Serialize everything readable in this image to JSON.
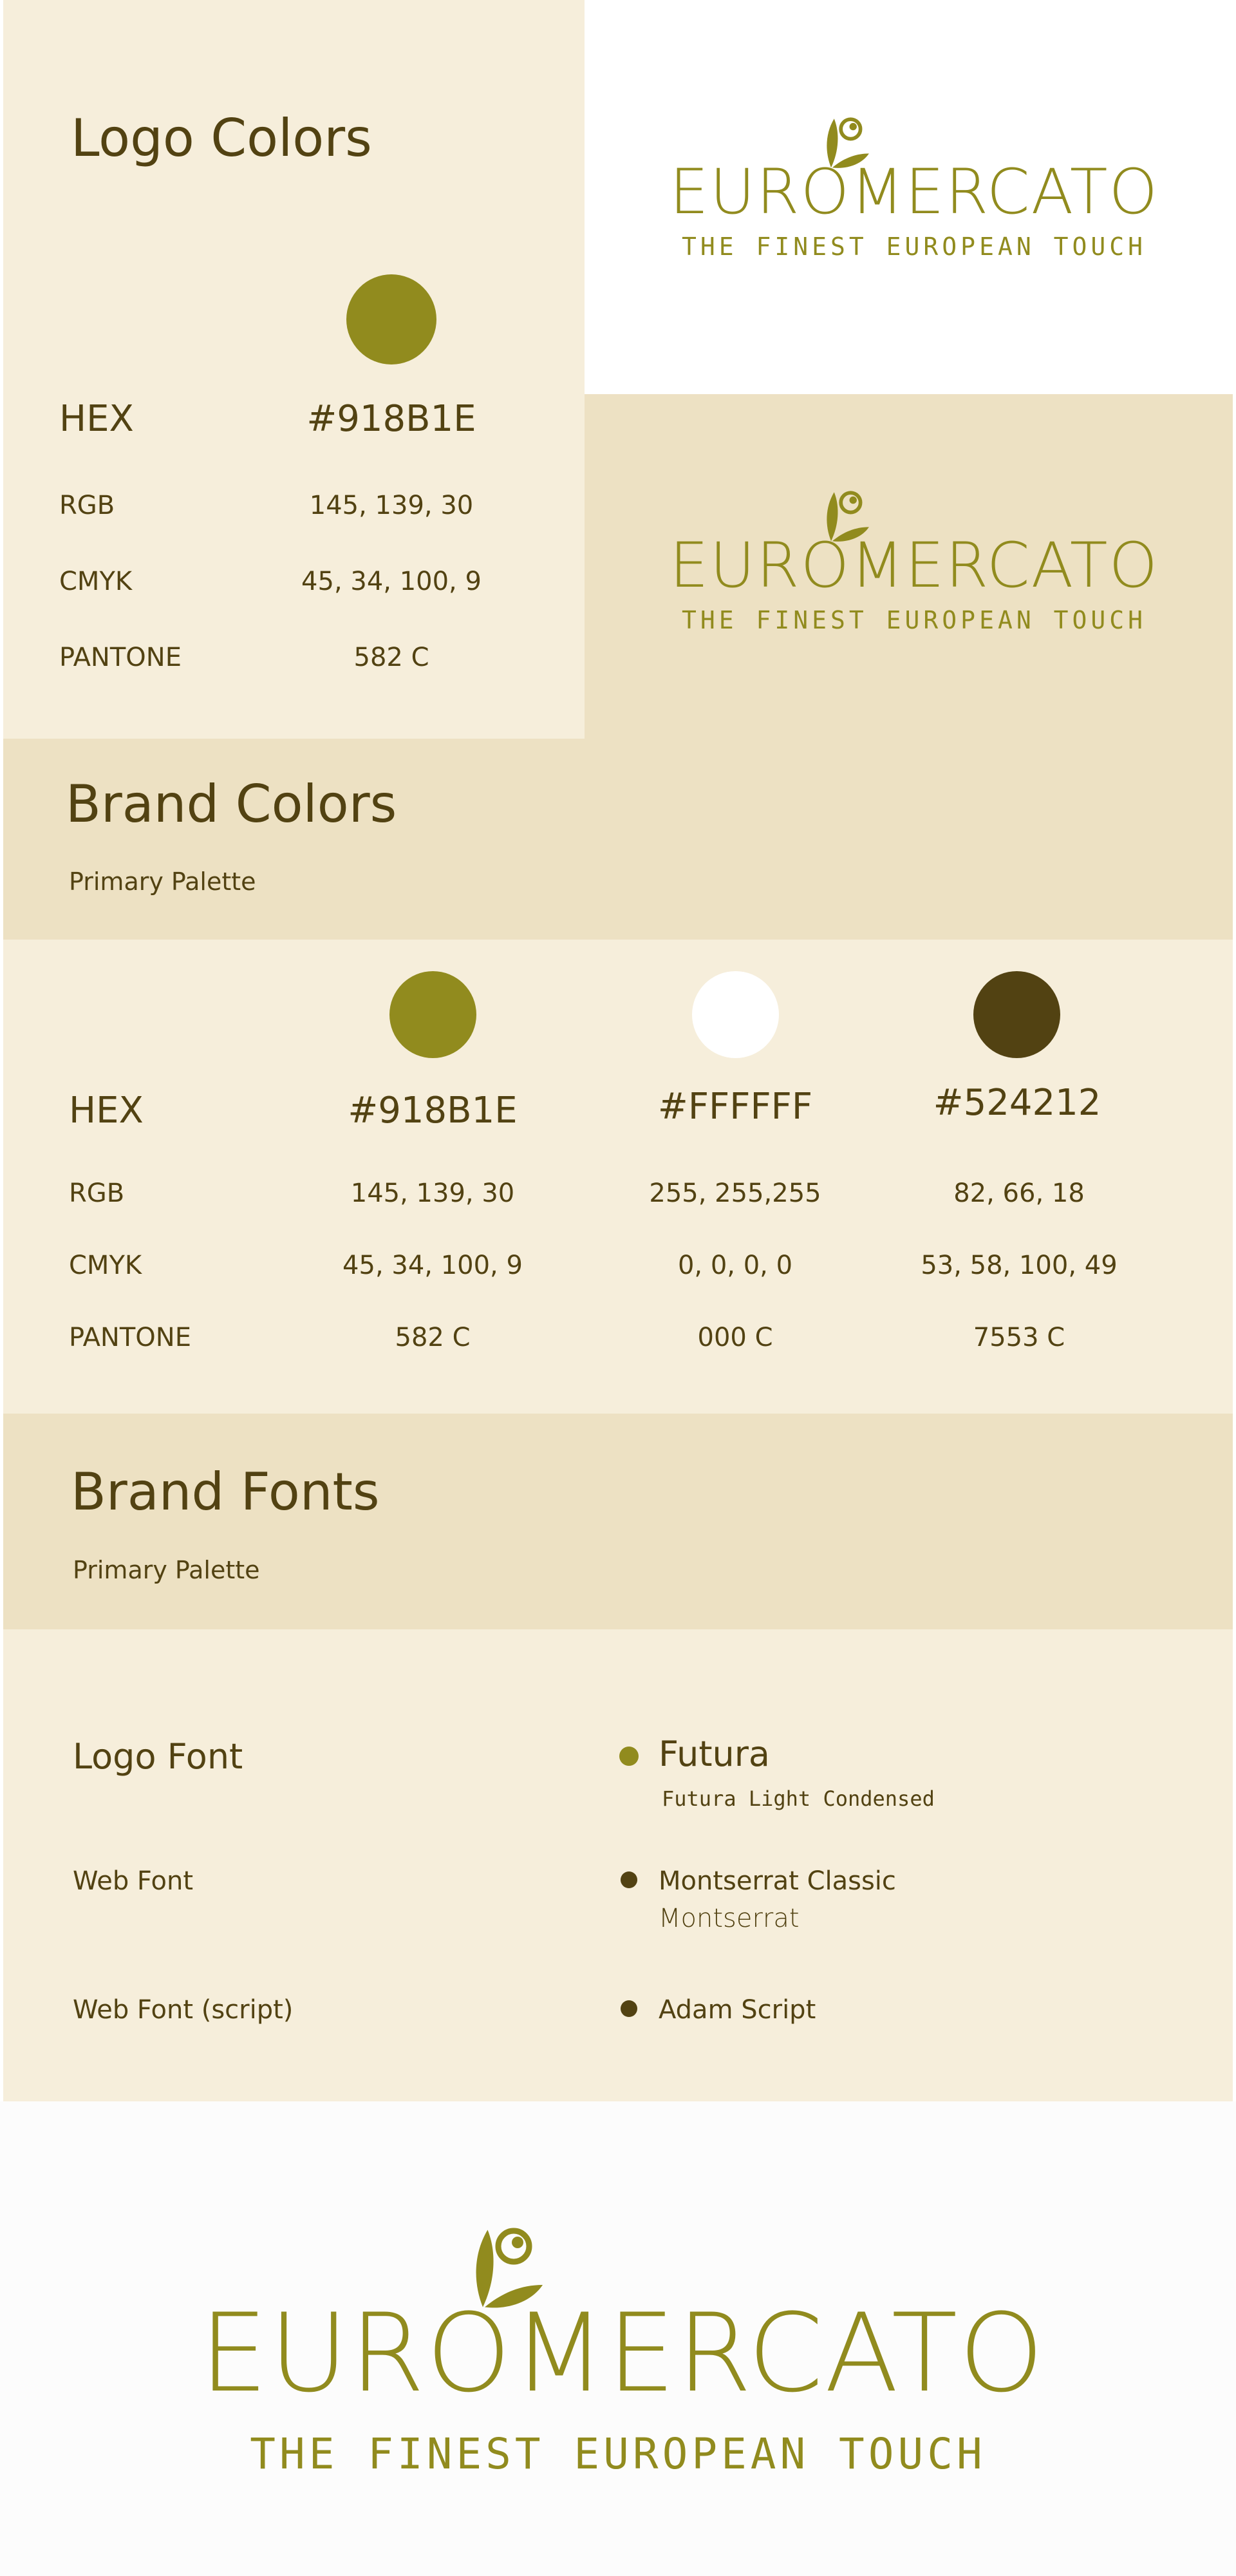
{
  "colors": {
    "primary": "#918B1E",
    "white": "#FFFFFF",
    "dark": "#524212",
    "panel_light": "#F6EEDB",
    "panel_mid": "#EDE1C3"
  },
  "logo": {
    "wordmark": "EUROMERCATO",
    "tagline": "THE FINEST EUROPEAN TOUCH",
    "icon": "olive-branch-icon"
  },
  "logo_colors": {
    "title": "Logo Colors",
    "rows": [
      {
        "label": "HEX",
        "value": "#918B1E"
      },
      {
        "label": "RGB",
        "value": "145, 139, 30"
      },
      {
        "label": "CMYK",
        "value": "45, 34, 100, 9"
      },
      {
        "label": "PANTONE",
        "value": "582 C"
      }
    ]
  },
  "brand_colors": {
    "title": "Brand Colors",
    "subtitle": "Primary Palette",
    "labels": [
      "HEX",
      "RGB",
      "CMYK",
      "PANTONE"
    ],
    "swatches": [
      {
        "hex": "#918B1E",
        "rgb": "145, 139, 30",
        "cmyk": "45, 34, 100, 9",
        "pantone": "582 C"
      },
      {
        "hex": "#FFFFFF",
        "rgb": "255, 255,255",
        "cmyk": "0, 0, 0, 0",
        "pantone": "000 C"
      },
      {
        "hex": "#524212",
        "rgb": "82, 66, 18",
        "cmyk": "53, 58, 100, 49",
        "pantone": "7553 C"
      }
    ]
  },
  "brand_fonts": {
    "title": "Brand Fonts",
    "subtitle": "Primary Palette",
    "rows": [
      {
        "label": "Logo Font",
        "name": "Futura",
        "note": "Futura Light Condensed"
      },
      {
        "label": "Web Font",
        "name": "Montserrat Classic",
        "note": "Montserrat"
      },
      {
        "label": "Web Font (script)",
        "name": "Adam Script",
        "note": ""
      }
    ]
  }
}
